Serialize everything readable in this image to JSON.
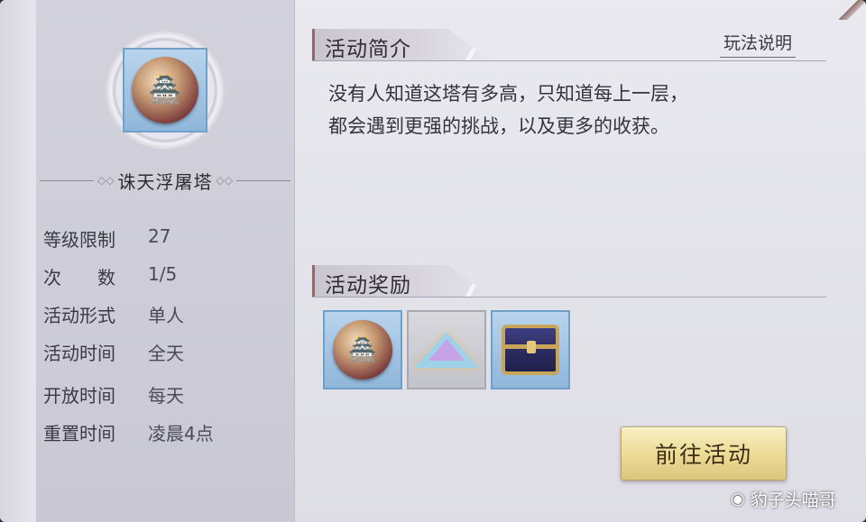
{
  "left": {
    "activity_name": "诛天浮屠塔",
    "emblem_icon": "tower-orb-icon",
    "info": [
      {
        "label": "等级限制",
        "value": "27"
      },
      {
        "label": "次　　数",
        "value": "1/5"
      },
      {
        "label": "活动形式",
        "value": "单人"
      },
      {
        "label": "活动时间",
        "value": "全天"
      },
      {
        "label": "开放时间",
        "value": "每天"
      },
      {
        "label": "重置时间",
        "value": "凌晨4点"
      }
    ]
  },
  "intro": {
    "title": "活动简介",
    "rules_button": "玩法说明",
    "line1": "没有人知道这塔有多高，只知道每上一层，",
    "line2": "都会遇到更强的挑战，以及更多的收获。"
  },
  "rewards": {
    "title": "活动奖励",
    "items": [
      "tower-orb-icon",
      "crystal-pyramid-icon",
      "treasure-chest-icon"
    ]
  },
  "go_button": "前往活动",
  "watermark": "豹子头喵哥",
  "colors": {
    "button_gold": "#ecd993",
    "icon_frame_blue": "#6fa0c9"
  }
}
